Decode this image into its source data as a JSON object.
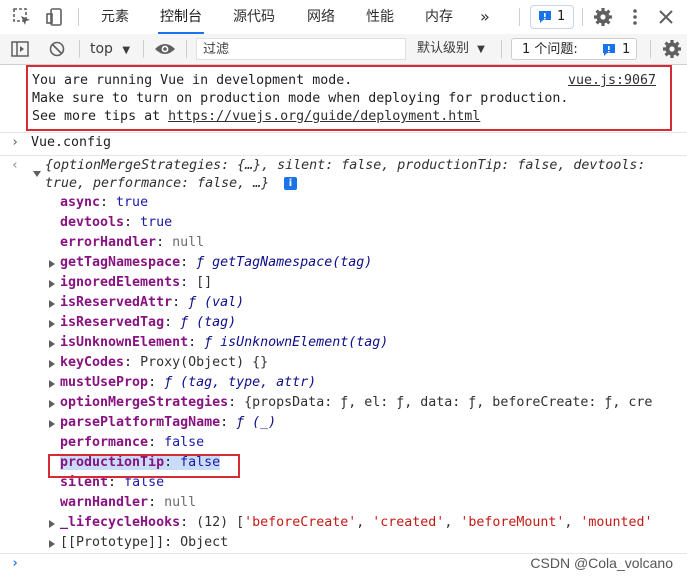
{
  "tabs": [
    "元素",
    "控制台",
    "源代码",
    "网络",
    "性能",
    "内存"
  ],
  "more_tabs": "»",
  "issues_badge_count": "1",
  "toolbar": {
    "context": "top",
    "filter_placeholder": "过滤",
    "level": "默认级别",
    "issues_label": "1 个问题:",
    "issues_count": "1"
  },
  "vue_message": {
    "line1": "You are running Vue in development mode.",
    "source": "vue.js:9067",
    "line2": "Make sure to turn on production mode when deploying for production.",
    "line3_prefix": "See more tips at ",
    "line3_link": "https://vuejs.org/guide/deployment.html"
  },
  "input": "Vue.config",
  "summary_line1": "{optionMergeStrategies: {…}, silent: false, productionTip: false, devtools:",
  "summary_line2": "true, performance: false, …}",
  "props": [
    {
      "key": "async",
      "sep": ": ",
      "val": "true",
      "kind": "bool",
      "expand": false
    },
    {
      "key": "devtools",
      "sep": ": ",
      "val": "true",
      "kind": "bool",
      "expand": false
    },
    {
      "key": "errorHandler",
      "sep": ": ",
      "val": "null",
      "kind": "null",
      "expand": false
    },
    {
      "key": "getTagNamespace",
      "sep": ": ",
      "val": "ƒ getTagNamespace(tag)",
      "kind": "fn",
      "expand": true
    },
    {
      "key": "ignoredElements",
      "sep": ": ",
      "val": "[]",
      "kind": "obj",
      "expand": true
    },
    {
      "key": "isReservedAttr",
      "sep": ": ",
      "val": "ƒ (val)",
      "kind": "fn",
      "expand": true
    },
    {
      "key": "isReservedTag",
      "sep": ": ",
      "val": "ƒ (tag)",
      "kind": "fn",
      "expand": true
    },
    {
      "key": "isUnknownElement",
      "sep": ": ",
      "val": "ƒ isUnknownElement(tag)",
      "kind": "fn",
      "expand": true
    },
    {
      "key": "keyCodes",
      "sep": ": ",
      "val": "Proxy(Object) {}",
      "kind": "obj",
      "expand": true
    },
    {
      "key": "mustUseProp",
      "sep": ": ",
      "val": "ƒ (tag, type, attr)",
      "kind": "fn",
      "expand": true
    },
    {
      "key": "optionMergeStrategies",
      "sep": ": ",
      "val": "{propsData: ƒ, el: ƒ, data: ƒ, beforeCreate: ƒ, cre",
      "kind": "obj",
      "expand": true
    },
    {
      "key": "parsePlatformTagName",
      "sep": ": ",
      "val": "ƒ (_)",
      "kind": "fn",
      "expand": true
    },
    {
      "key": "performance",
      "sep": ": ",
      "val": "false",
      "kind": "bool",
      "expand": false
    },
    {
      "key": "productionTip",
      "sep": ": ",
      "val": "false",
      "kind": "bool",
      "expand": false,
      "highlight": true
    },
    {
      "key": "silent",
      "sep": ": ",
      "val": "false",
      "kind": "bool",
      "expand": false
    },
    {
      "key": "warnHandler",
      "sep": ": ",
      "val": "null",
      "kind": "null",
      "expand": false
    },
    {
      "key": "_lifecycleHooks",
      "sep": ": ",
      "val": "(12) ['beforeCreate', 'created', 'beforeMount', 'mounted'",
      "kind": "arr",
      "expand": true
    },
    {
      "key": "[[Prototype]]",
      "sep": ": ",
      "val": "Object",
      "kind": "proto",
      "expand": true
    }
  ],
  "watermark": "CSDN @Cola_volcano"
}
